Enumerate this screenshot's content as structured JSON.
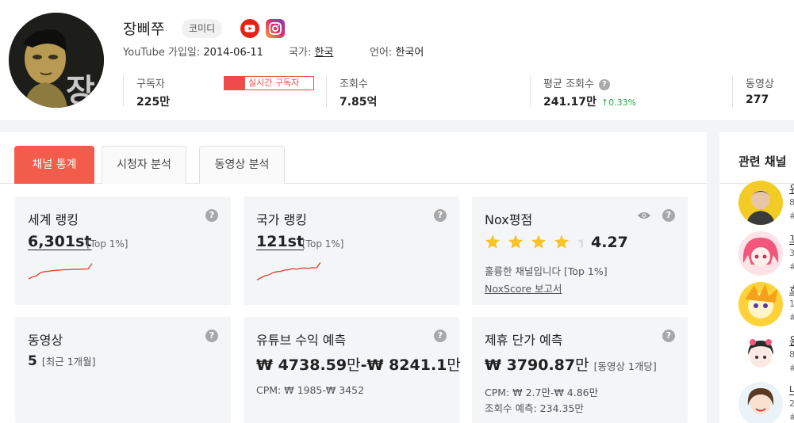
{
  "channel": {
    "name": "장삐쭈",
    "category": "코미디",
    "joined_label": "YouTube 가입일:",
    "joined_value": "2014-06-11",
    "country_label": "국가:",
    "country_value": "한국",
    "language_label": "언어:",
    "language_value": "한국어",
    "avatar_text": "장"
  },
  "stats": {
    "subscribers": {
      "label": "구독자",
      "value": "225만"
    },
    "realtime_badge": "실시간 구독자",
    "views": {
      "label": "조회수",
      "value": "7.85억"
    },
    "avg_views": {
      "label": "평균 조회수",
      "value": "241.17만",
      "growth": "↑0.33%"
    },
    "videos": {
      "label": "동영상",
      "value": "277"
    }
  },
  "tabs": [
    {
      "label": "채널 통계",
      "active": true
    },
    {
      "label": "시청자 분석",
      "active": false
    },
    {
      "label": "동영상 분석",
      "active": false
    }
  ],
  "cards": {
    "world_rank": {
      "title": "세계 랭킹",
      "value": "6,301st",
      "top": "[Top 1%]",
      "trend": [
        0.15,
        0.25,
        0.3,
        0.45,
        0.5,
        0.52,
        0.55,
        0.57,
        0.58,
        0.6,
        0.6,
        0.61,
        0.62,
        0.62,
        0.63,
        0.63,
        0.9
      ]
    },
    "country_rank": {
      "title": "국가 랭킹",
      "value": "121st",
      "top": "[Top 1%]",
      "trend": [
        0.1,
        0.2,
        0.3,
        0.35,
        0.45,
        0.5,
        0.52,
        0.58,
        0.6,
        0.65,
        0.62,
        0.66,
        0.68,
        0.66,
        0.7,
        0.68,
        0.95
      ]
    },
    "nox": {
      "title": "Nox평점",
      "rating": 4.27,
      "rating_text": "4.27",
      "desc": "훌륭한 채널입니다 [Top 1%]",
      "report_link": "NoxScore 보고서"
    },
    "videos": {
      "title": "동영상",
      "value": "5",
      "sub": "[최근 1개월]"
    },
    "revenue": {
      "title": "유튜브 수익 예측",
      "low": "₩ 4738.59",
      "high": "₩ 8241.1",
      "unit": "만",
      "dash": "-",
      "cpm": "CPM: ₩ 1985-₩ 3452"
    },
    "partner": {
      "title": "제휴 단가 예측",
      "value": "₩ 3790.87",
      "unit": "만",
      "per": "[동영상 1개당]",
      "cpm": "CPM: ₩ 2.7만-₩ 4.86만",
      "views_est": "조회수 예측: 234.35만"
    }
  },
  "sidebar": {
    "title": "관련 채널",
    "items": [
      {
        "name": "유",
        "sub": "8",
        "tag": "#"
      },
      {
        "name": "꼬",
        "sub": "3",
        "tag": "#"
      },
      {
        "name": "흐",
        "sub": "1",
        "tag": "#"
      },
      {
        "name": "윤",
        "sub": "8",
        "tag": "#"
      },
      {
        "name": "나",
        "sub": "2",
        "tag": "#"
      }
    ]
  },
  "colors": {
    "accent": "#f25c4b",
    "spark": "#e04a3b",
    "star_on": "#f7c325",
    "star_off": "#dcdcdc",
    "growth": "#2aa84a"
  }
}
